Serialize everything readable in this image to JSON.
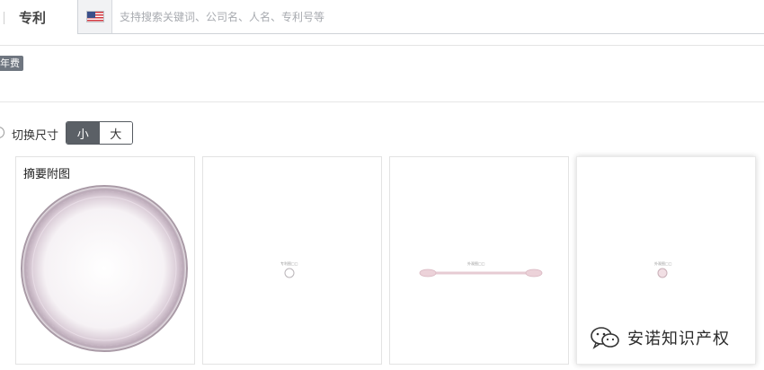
{
  "header": {
    "tab_label": "专利",
    "country_flag_icon": "us-flag-icon",
    "search_placeholder": "支持搜索关键词、公司名、人名、专利号等"
  },
  "filters": {
    "fee_tag": "年费"
  },
  "view": {
    "size_switch_label": "切换尺寸",
    "size_small": "小",
    "size_large": "大",
    "selected_size": "小"
  },
  "figures": [
    {
      "title": "摘要附图",
      "caption": ""
    },
    {
      "title": "",
      "caption": "专利图□□"
    },
    {
      "title": "",
      "caption": "外观图□□"
    },
    {
      "title": "",
      "caption": "外观图□□"
    }
  ],
  "watermark": {
    "text": "安诺知识产权",
    "icon": "wechat-icon"
  },
  "colors": {
    "tag_bg": "#6f7680",
    "toggle_active": "#5b6066"
  }
}
